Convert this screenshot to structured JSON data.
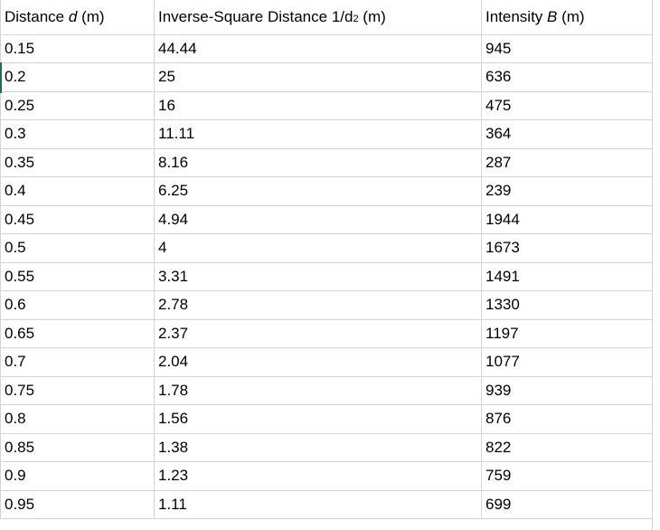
{
  "header": {
    "col_a": {
      "prefix": "Distance ",
      "var": "d",
      "suffix": " (m)"
    },
    "col_b": {
      "prefix": "Inverse-Square Distance 1/d",
      "sub": "2",
      "suffix": " (m)"
    },
    "col_c": {
      "prefix": "Intensity ",
      "var": "B",
      "suffix": " (m)"
    }
  },
  "rows": [
    {
      "distance": "0.15",
      "inverse": "44.44",
      "intensity": "945"
    },
    {
      "distance": "0.2",
      "inverse": "25",
      "intensity": "636"
    },
    {
      "distance": "0.25",
      "inverse": "16",
      "intensity": "475"
    },
    {
      "distance": "0.3",
      "inverse": "11.11",
      "intensity": "364"
    },
    {
      "distance": "0.35",
      "inverse": "8.16",
      "intensity": "287"
    },
    {
      "distance": "0.4",
      "inverse": "6.25",
      "intensity": "239"
    },
    {
      "distance": "0.45",
      "inverse": "4.94",
      "intensity": "1944"
    },
    {
      "distance": "0.5",
      "inverse": "4",
      "intensity": "1673"
    },
    {
      "distance": "0.55",
      "inverse": "3.31",
      "intensity": "1491"
    },
    {
      "distance": "0.6",
      "inverse": "2.78",
      "intensity": "1330"
    },
    {
      "distance": "0.65",
      "inverse": "2.37",
      "intensity": "1197"
    },
    {
      "distance": "0.7",
      "inverse": "2.04",
      "intensity": "1077"
    },
    {
      "distance": "0.75",
      "inverse": "1.78",
      "intensity": "939"
    },
    {
      "distance": "0.8",
      "inverse": "1.56",
      "intensity": "876"
    },
    {
      "distance": "0.85",
      "inverse": "1.38",
      "intensity": "822"
    },
    {
      "distance": "0.9",
      "inverse": "1.23",
      "intensity": "759"
    },
    {
      "distance": "0.95",
      "inverse": "1.11",
      "intensity": "699"
    }
  ]
}
